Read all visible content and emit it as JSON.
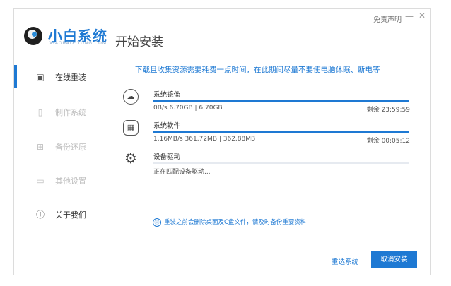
{
  "window": {
    "disclaimer": "免责声明",
    "minimize": "—",
    "close": "✕"
  },
  "logo": {
    "name": "小白系统",
    "url": "XIAOBAIXITONG.COM"
  },
  "page_title": "开始安装",
  "sidebar": {
    "items": [
      {
        "label": "在线重装",
        "icon": "monitor-icon",
        "glyph": "▣",
        "active": true
      },
      {
        "label": "制作系统",
        "icon": "usb-icon",
        "glyph": "▯",
        "active": false
      },
      {
        "label": "备份还原",
        "icon": "backup-icon",
        "glyph": "⊞",
        "active": false
      },
      {
        "label": "其他设置",
        "icon": "settings-icon",
        "glyph": "▭",
        "active": false
      },
      {
        "label": "关于我们",
        "icon": "info-icon",
        "glyph": "ⓘ",
        "active": false
      }
    ]
  },
  "notice": "下载且收集资源需要耗费一点时间，在此期间尽量不要使电脑休眠、断电等",
  "tasks": [
    {
      "name": "系统镜像",
      "stats": "0B/s 6.70GB | 6.70GB",
      "remain": "剩余 23:59:59",
      "progress": 1.0,
      "icon": "cloud-icon",
      "glyph": "☁"
    },
    {
      "name": "系统软件",
      "stats": "1.16MB/s 361.72MB | 362.88MB",
      "remain": "剩余 00:05:12",
      "progress": 0.997,
      "icon": "apps-icon",
      "glyph": "▦"
    },
    {
      "name": "设备驱动",
      "stats": "正在匹配设备驱动...",
      "remain": "",
      "progress": 0.0,
      "icon": "gear-icon",
      "glyph": "⚙"
    }
  ],
  "warning": "重装之前会删除桌面及C盘文件，请及时备份重要资料",
  "warning_icon": "ⓘ",
  "buttons": {
    "reselect": "重选系统",
    "cancel": "取消安装"
  },
  "colors": {
    "accent": "#1e79d3"
  }
}
